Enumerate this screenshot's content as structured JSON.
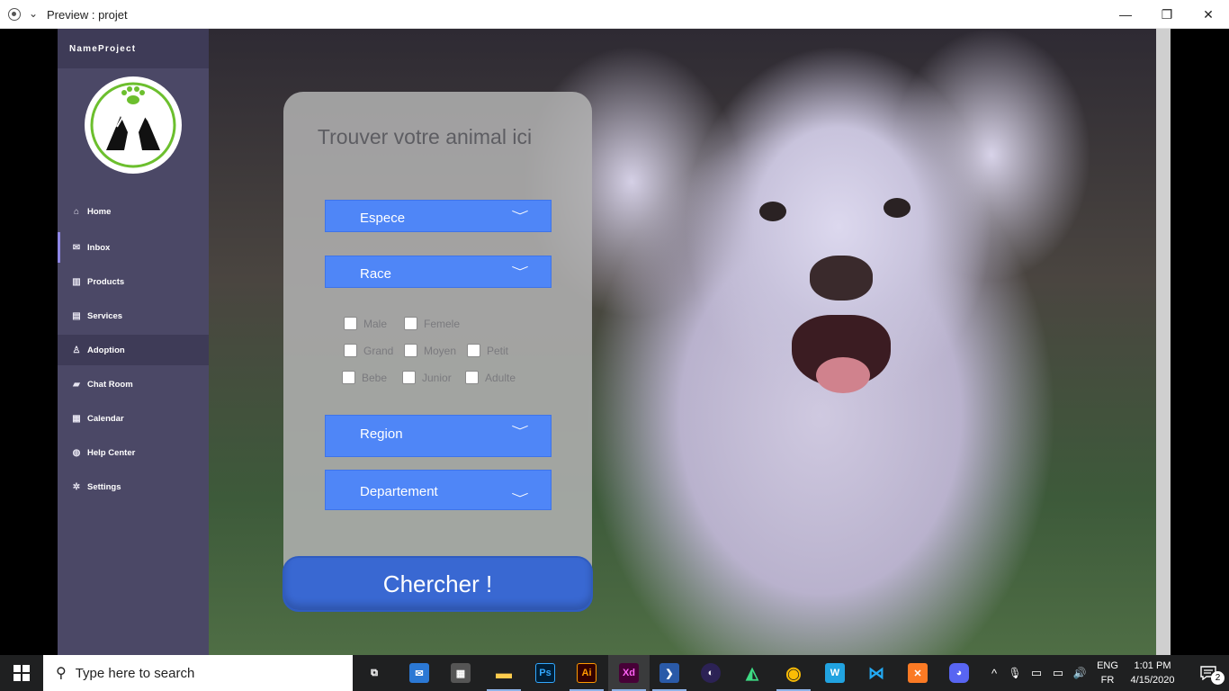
{
  "window": {
    "title": "Preview : projet",
    "minimize": "—",
    "maximize": "❐",
    "close": "✕"
  },
  "sidebar": {
    "brand": "NameProject",
    "items": [
      {
        "label": "Home",
        "icon": "home-icon",
        "glyph": "⌂"
      },
      {
        "label": "Inbox",
        "icon": "mail-icon",
        "glyph": "✉"
      },
      {
        "label": "Products",
        "icon": "barcode-icon",
        "glyph": "▥"
      },
      {
        "label": "Services",
        "icon": "list-icon",
        "glyph": "▤"
      },
      {
        "label": "Adoption",
        "icon": "user-icon",
        "glyph": "♙"
      },
      {
        "label": "Chat Room",
        "icon": "chat-icon",
        "glyph": "▰"
      },
      {
        "label": "Calendar",
        "icon": "calendar-icon",
        "glyph": "▦"
      },
      {
        "label": "Help Center",
        "icon": "globe-icon",
        "glyph": "◍"
      },
      {
        "label": "Settings",
        "icon": "gear-icon",
        "glyph": "✲"
      }
    ],
    "active": "Inbox",
    "highlighted": "Adoption"
  },
  "form": {
    "title": "Trouver votre animal ici",
    "espece": "Espece",
    "race": "Race",
    "region": "Region",
    "departement": "Departement",
    "chevron": "﹀",
    "checkboxes": {
      "male": "Male",
      "femele": "Femele",
      "grand": "Grand",
      "moyen": "Moyen",
      "petit": "Petit",
      "bebe": "Bebe",
      "junior": "Junior",
      "adulte": "Adulte"
    },
    "search_button": "Chercher !"
  },
  "taskbar": {
    "search_placeholder": "Type here to search",
    "apps": [
      {
        "name": "task-view",
        "glyph": "⧉",
        "color": "#ffffff",
        "bg": "transparent"
      },
      {
        "name": "mail",
        "glyph": "✉",
        "color": "#ffffff",
        "bg": "#2b78d4"
      },
      {
        "name": "store",
        "glyph": "▦",
        "color": "#ffffff",
        "bg": "#555555"
      },
      {
        "name": "file-explorer",
        "glyph": "▬",
        "color": "#ffcc4d",
        "bg": "transparent"
      },
      {
        "name": "photoshop",
        "glyph": "Ps",
        "color": "#31a8ff",
        "bg": "#001e36"
      },
      {
        "name": "illustrator",
        "glyph": "Ai",
        "color": "#ff9a00",
        "bg": "#330000"
      },
      {
        "name": "adobe-xd",
        "glyph": "Xd",
        "color": "#ff61f6",
        "bg": "#470137"
      },
      {
        "name": "powershell",
        "glyph": "❯",
        "color": "#ffffff",
        "bg": "#2a5aa8"
      },
      {
        "name": "eclipse",
        "glyph": "◐",
        "color": "#ffffff",
        "bg": "#2c2255"
      },
      {
        "name": "android-studio",
        "glyph": "◭",
        "color": "#3ddc84",
        "bg": "transparent"
      },
      {
        "name": "chrome",
        "glyph": "◉",
        "color": "#fbbc05",
        "bg": "transparent"
      },
      {
        "name": "webstorm",
        "glyph": "W",
        "color": "#ffffff",
        "bg": "#21a3e0"
      },
      {
        "name": "vscode",
        "glyph": "⋈",
        "color": "#23a9f2",
        "bg": "transparent"
      },
      {
        "name": "xampp",
        "glyph": "✕",
        "color": "#ffffff",
        "bg": "#fb7a24"
      },
      {
        "name": "discord",
        "glyph": "◕",
        "color": "#ffffff",
        "bg": "#5865f2"
      }
    ],
    "tray": {
      "chevron": "^",
      "mic": "🎙",
      "battery": "▭",
      "network": "▭",
      "volume": "🔊"
    },
    "lang_top": "ENG",
    "lang_bottom": "FR",
    "time": "1:01 PM",
    "date": "4/15/2020",
    "notification_count": "2"
  }
}
